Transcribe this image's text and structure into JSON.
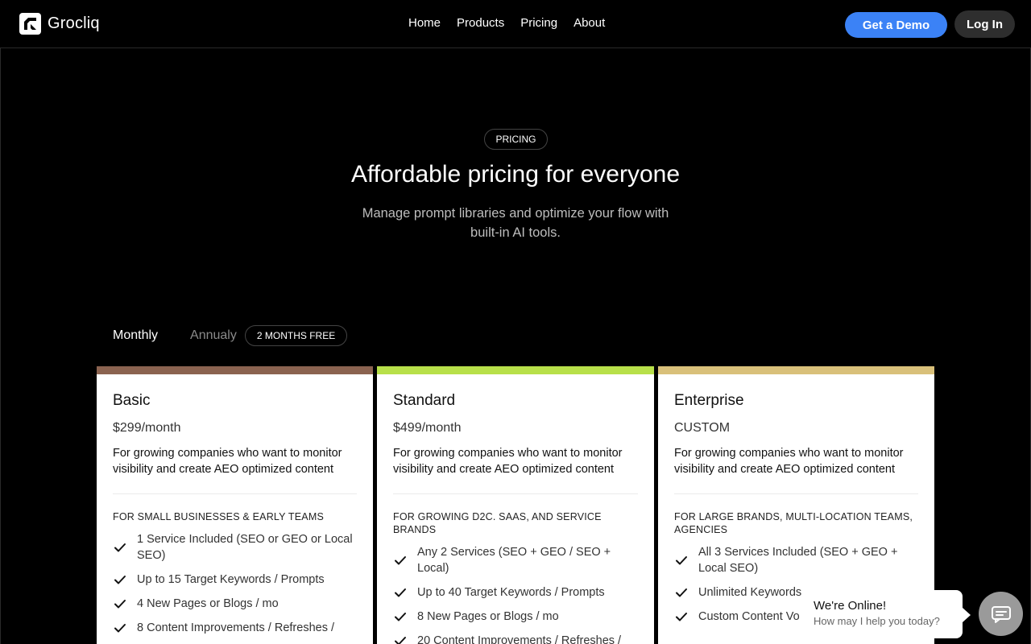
{
  "nav": {
    "brand": "Grocliq",
    "links": [
      "Home",
      "Products",
      "Pricing",
      "About"
    ],
    "demo_label": "Get a Demo",
    "login_label": "Log In",
    "accent_color": "#3b82f6"
  },
  "hero": {
    "badge": "PRICING",
    "title": "Affordable pricing for everyone",
    "subtitle": "Manage prompt libraries and optimize your flow with built-in AI tools."
  },
  "billing": {
    "monthly_label": "Monthly",
    "annual_label": "Annualy",
    "annual_badge": "2 MONTHS FREE",
    "selected": "Monthly"
  },
  "plans": [
    {
      "name": "Basic",
      "price": "$299/month",
      "description": "For growing companies who want to monitor visibility and create AEO optimized content",
      "audience": "FOR SMALL BUSINESSES & EARLY TEAMS",
      "accent": "#8b6350",
      "features": [
        "1 Service Included (SEO or GEO or Local SEO)",
        "Up to 15 Target Keywords / Prompts",
        "4 New Pages or Blogs / mo",
        "8 Content Improvements / Refreshes /"
      ]
    },
    {
      "name": "Standard",
      "price": "$499/month",
      "description": "For growing companies who want to monitor visibility and create AEO optimized content",
      "audience": "FOR GROWING D2C. SAAS, AND SERVICE BRANDS",
      "accent": "#b8e04a",
      "features": [
        "Any 2 Services (SEO + GEO / SEO + Local)",
        "Up to 40 Target Keywords / Prompts",
        "8 New Pages or Blogs / mo",
        "20 Content Improvements / Refreshes /"
      ]
    },
    {
      "name": "Enterprise",
      "price": "CUSTOM",
      "description": "For growing companies who want to monitor visibility and create AEO optimized content",
      "audience": "FOR LARGE BRANDS, MULTI-LOCATION TEAMS, AGENCIES",
      "accent": "#d9c07a",
      "features": [
        "All 3 Services Included (SEO + GEO + Local SEO)",
        "Unlimited Keywords",
        "Custom Content Vo"
      ]
    }
  ],
  "chat": {
    "title": "We're Online!",
    "subtitle": "How may I help you today?",
    "launcher_icon": "chat-icon"
  }
}
